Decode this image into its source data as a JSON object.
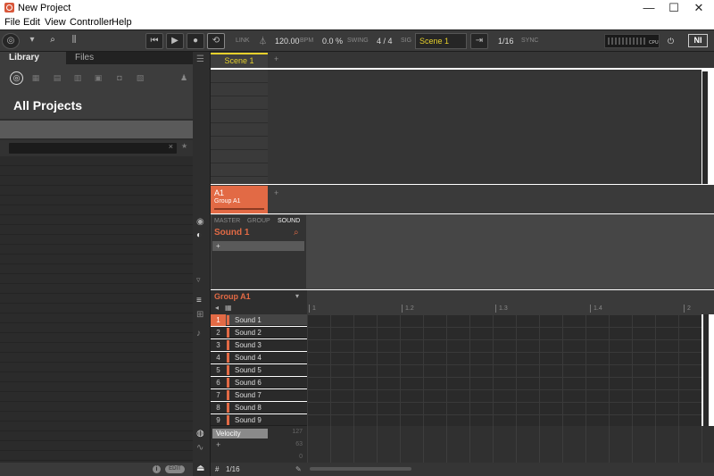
{
  "window": {
    "title": "New Project",
    "minimize": "—",
    "maximize": "☐",
    "close": "✕"
  },
  "menu": [
    "File",
    "Edit",
    "View",
    "Controller",
    "Help"
  ],
  "toolbar": {
    "link": "LINK",
    "tempo": "120.00",
    "tempo_unit": "BPM",
    "swing": "0.0 %",
    "swing_label": "SWING",
    "signature": "4 / 4",
    "sig_label": "SIG",
    "scene": "Scene 1",
    "quantize": "1/16",
    "sync_label": "SYNC",
    "cpu_label": "CPU",
    "brand": "NI"
  },
  "browser": {
    "tabs": [
      "Library",
      "Files"
    ],
    "heading": "All Projects",
    "clear_glyph": "×",
    "star_glyph": "★",
    "footer_info": "i",
    "footer_edit": "EDIT"
  },
  "arranger": {
    "scene_tab": "Scene 1",
    "add_glyph": "+",
    "group_code": "A1",
    "group_name": "Group A1"
  },
  "control": {
    "tabs": [
      "MASTER",
      "GROUP",
      "SOUND"
    ],
    "sound_name": "Sound 1",
    "add_glyph": "+"
  },
  "pattern": {
    "group_name": "Group A1",
    "ruler": [
      "1",
      "1.2",
      "1.3",
      "1.4",
      "2"
    ],
    "sounds": [
      {
        "num": "1",
        "name": "Sound 1"
      },
      {
        "num": "2",
        "name": "Sound 2"
      },
      {
        "num": "3",
        "name": "Sound 3"
      },
      {
        "num": "4",
        "name": "Sound 4"
      },
      {
        "num": "5",
        "name": "Sound 5"
      },
      {
        "num": "6",
        "name": "Sound 6"
      },
      {
        "num": "7",
        "name": "Sound 7"
      },
      {
        "num": "8",
        "name": "Sound 8"
      },
      {
        "num": "9",
        "name": "Sound 9"
      }
    ],
    "velocity_label": "Velocity",
    "velocity_max": "127",
    "velocity_mid": "63",
    "velocity_min": "0",
    "add_glyph": "+",
    "grid_label": "1/16",
    "grid_hash": "#"
  },
  "colors": {
    "accent": "#e26a45",
    "scene_yellow": "#e6d02c",
    "panel_dark": "#2d2d2d"
  }
}
